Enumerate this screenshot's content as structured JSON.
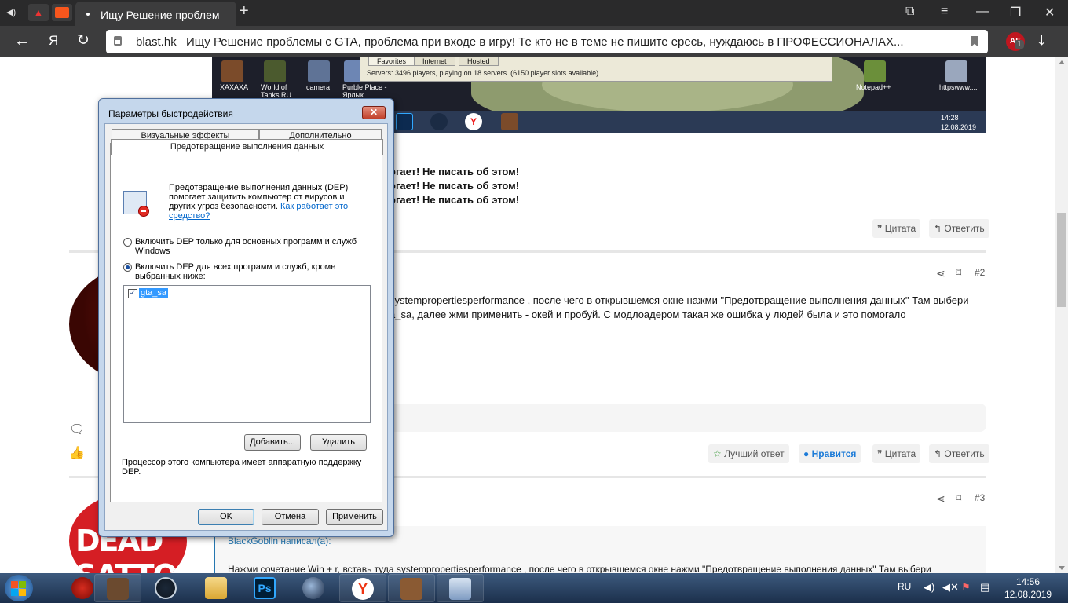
{
  "browser": {
    "tab_title": "Ищу Решение проблем",
    "url_host": "blast.hk",
    "page_title": "Ищу Решение проблемы с GTA, проблема при входе в игру! Те кто не в теме не пишите ересь, нуждаюсь в ПРОФЕССИОНАЛАХ...",
    "brand_char": "Я",
    "extension_label": "AE",
    "extension_badge": "1"
  },
  "screenshot": {
    "desktop_labels": [
      "XAXAXA",
      "World of Tanks RU",
      "camera",
      "Purble Place - Ярлык",
      "Notepad++",
      "httpswww...."
    ],
    "samp_tabs": [
      "Favorites",
      "Internet",
      "Hosted"
    ],
    "samp_status": "Servers: 3496 players, playing on 18 servers. (6150 player slots available)",
    "clock_time": "14:28",
    "clock_date": "12.08.2019",
    "taskbar_brand_char": "Y"
  },
  "post1": {
    "lines": [
      "огает! Не писать об этом!",
      "огает! Не писать об этом!",
      "огает! Не писать об этом!"
    ],
    "quote_label": "Цитата",
    "reply_label": "Ответить"
  },
  "post2": {
    "number": "#2",
    "line1": "systempropertiesperformance , после чего в открывшемся окне нажми \"Предотвращение выполнения данных\" Там выбери",
    "line2": "a_sa, далее жми применить - окей и пробуй. С модлоадером такая же ошибка у людей была и это помогало",
    "best_answer_label": "Лучший ответ",
    "like_label": "Нравится",
    "quote_label": "Цитата",
    "reply_label": "Ответить"
  },
  "post3": {
    "number": "#3",
    "avatar_text": "DEAD SATTO",
    "quote_author": "BlackGoblin написал(а):",
    "quote_text": "Нажми сочетание Win + r, вставь туда systempropertiesperformance , после чего в открывшемся окне нажми \"Предотвращение выполнения данных\" Там выбери"
  },
  "dialog": {
    "title": "Параметры быстродействия",
    "close_symbol": "✕",
    "tab_visual": "Визуальные эффекты",
    "tab_advanced": "Дополнительно",
    "tab_dep": "Предотвращение выполнения данных",
    "dep_description": "Предотвращение выполнения данных (DEP) помогает защитить компьютер от вирусов и других угроз безопасности. ",
    "dep_link": "Как работает это средство?",
    "radio1": "Включить DEP только для основных программ и служб Windows",
    "radio2": "Включить DEP для всех программ и служб, кроме выбранных ниже:",
    "list_item": "gta_sa",
    "check_mark": "✓",
    "add_button": "Добавить...",
    "remove_button": "Удалить",
    "cpu_note": "Процессор этого компьютера имеет аппаратную поддержку DEP.",
    "ok": "OK",
    "cancel": "Отмена",
    "apply": "Применить"
  },
  "taskbar": {
    "lang": "RU",
    "time": "14:56",
    "date": "12.08.2019",
    "brand_char": "Y"
  }
}
